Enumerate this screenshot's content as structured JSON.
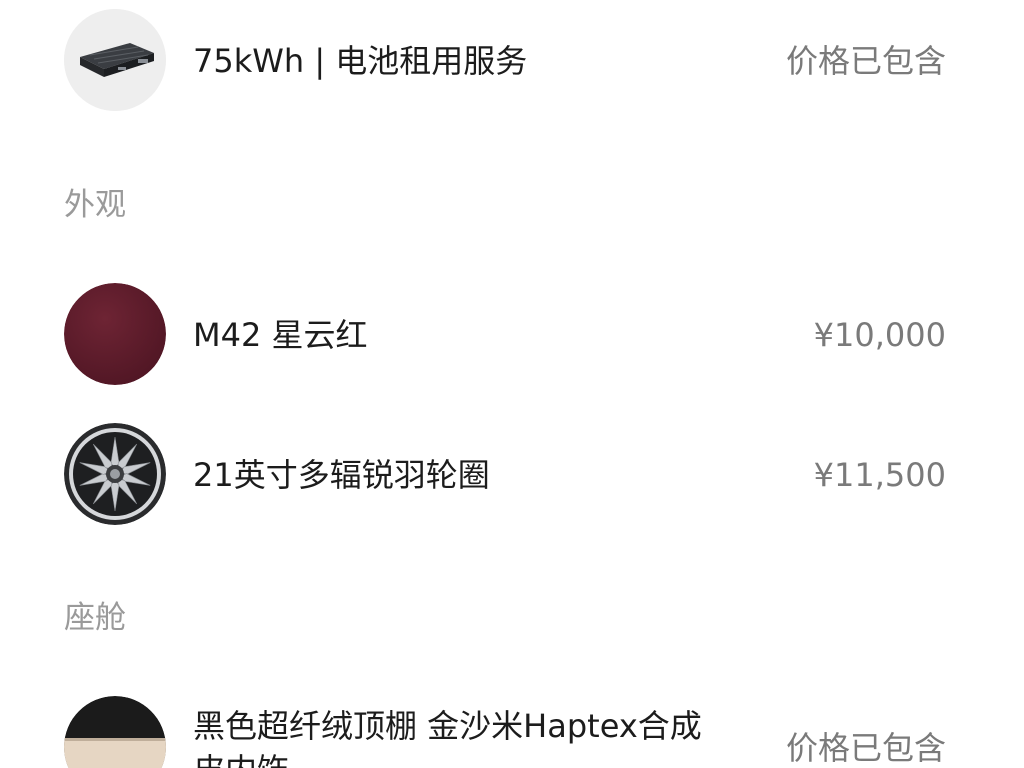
{
  "battery": {
    "name": "75kWh | 电池租用服务",
    "price": "价格已包含",
    "icon": "battery-pack-icon"
  },
  "sections": {
    "exterior_title": "外观",
    "cabin_title": "座舱"
  },
  "exterior_items": [
    {
      "name": "M42 星云红",
      "price": "¥10,000",
      "color": "#5e1c2b",
      "icon": "color-swatch-icon"
    },
    {
      "name": "21英寸多辐锐羽轮圈",
      "price": "¥11,500",
      "icon": "wheel-rim-icon"
    }
  ],
  "cabin_items": [
    {
      "name": "黑色超纤绒顶棚 金沙米Haptex合成皮内饰",
      "price": "价格已包含",
      "icon": "interior-swatch-icon"
    }
  ]
}
